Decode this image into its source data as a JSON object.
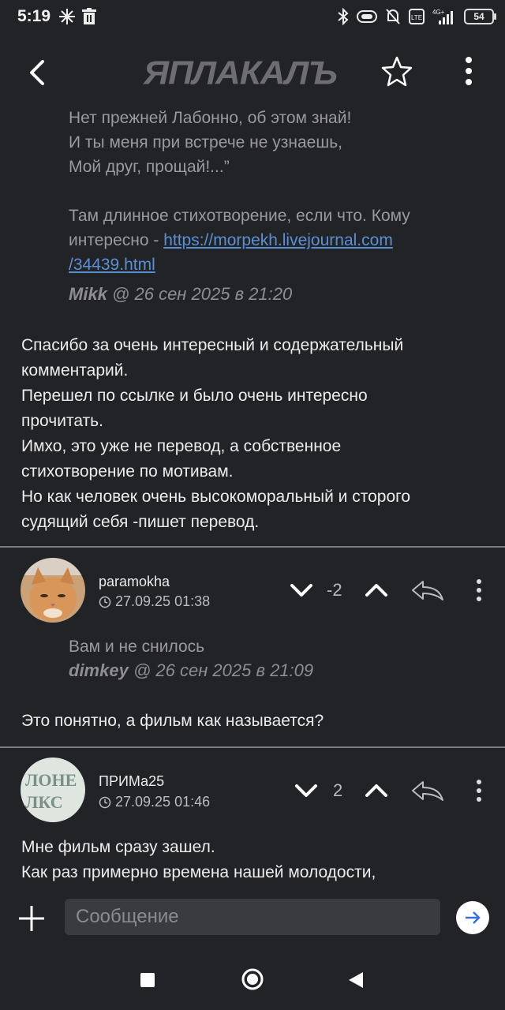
{
  "status": {
    "time": "5:19",
    "battery": "54",
    "net": "4G+"
  },
  "header": {
    "logo": "ЯПЛАКАЛЪ"
  },
  "quote1": {
    "lines": [
      "Нет прежней Лабонно, об этом знай!",
      "И ты меня при встрече не узнаешь,",
      "Мой друг, прощай!...”"
    ],
    "text2": "Там длинное стихотворение, если что. Кому",
    "text3": "интересно - ",
    "link1": "https://morpekh.livejournal.com",
    "link2": "/34439.html",
    "author": "Mikk",
    "date": " @ 26 сен 2025 в 21:20"
  },
  "comment1": {
    "lines": [
      "Спасибо за очень интересный и содержательный",
      "комментарий.",
      "Перешел по ссылке и было очень интересно",
      "прочитать.",
      "Имхо, это уже не перевод, а собственное",
      "стихотворение по мотивам.",
      "Но как человек очень высокоморальный и сторого",
      "судящий себя -пишет перевод."
    ]
  },
  "comment2": {
    "user": "paramokha",
    "time": "27.09.25 01:38",
    "votes": "-2",
    "quote": "Вам и не снилось",
    "quote_author": "dimkey",
    "quote_date": " @ 26 сен 2025 в 21:09",
    "text": "Это понятно, а фильм как называется?"
  },
  "comment3": {
    "user": "ПРИМа25",
    "time": "27.09.25 01:46",
    "votes": "2",
    "lines": [
      "Мне фильм сразу зашел.",
      "Как раз примерно времена нашей молодости,"
    ]
  },
  "composer": {
    "placeholder": "Сообщение"
  },
  "colors": {
    "bg": "#222327",
    "link": "#5b8fd4",
    "input": "#3a3b3f"
  }
}
